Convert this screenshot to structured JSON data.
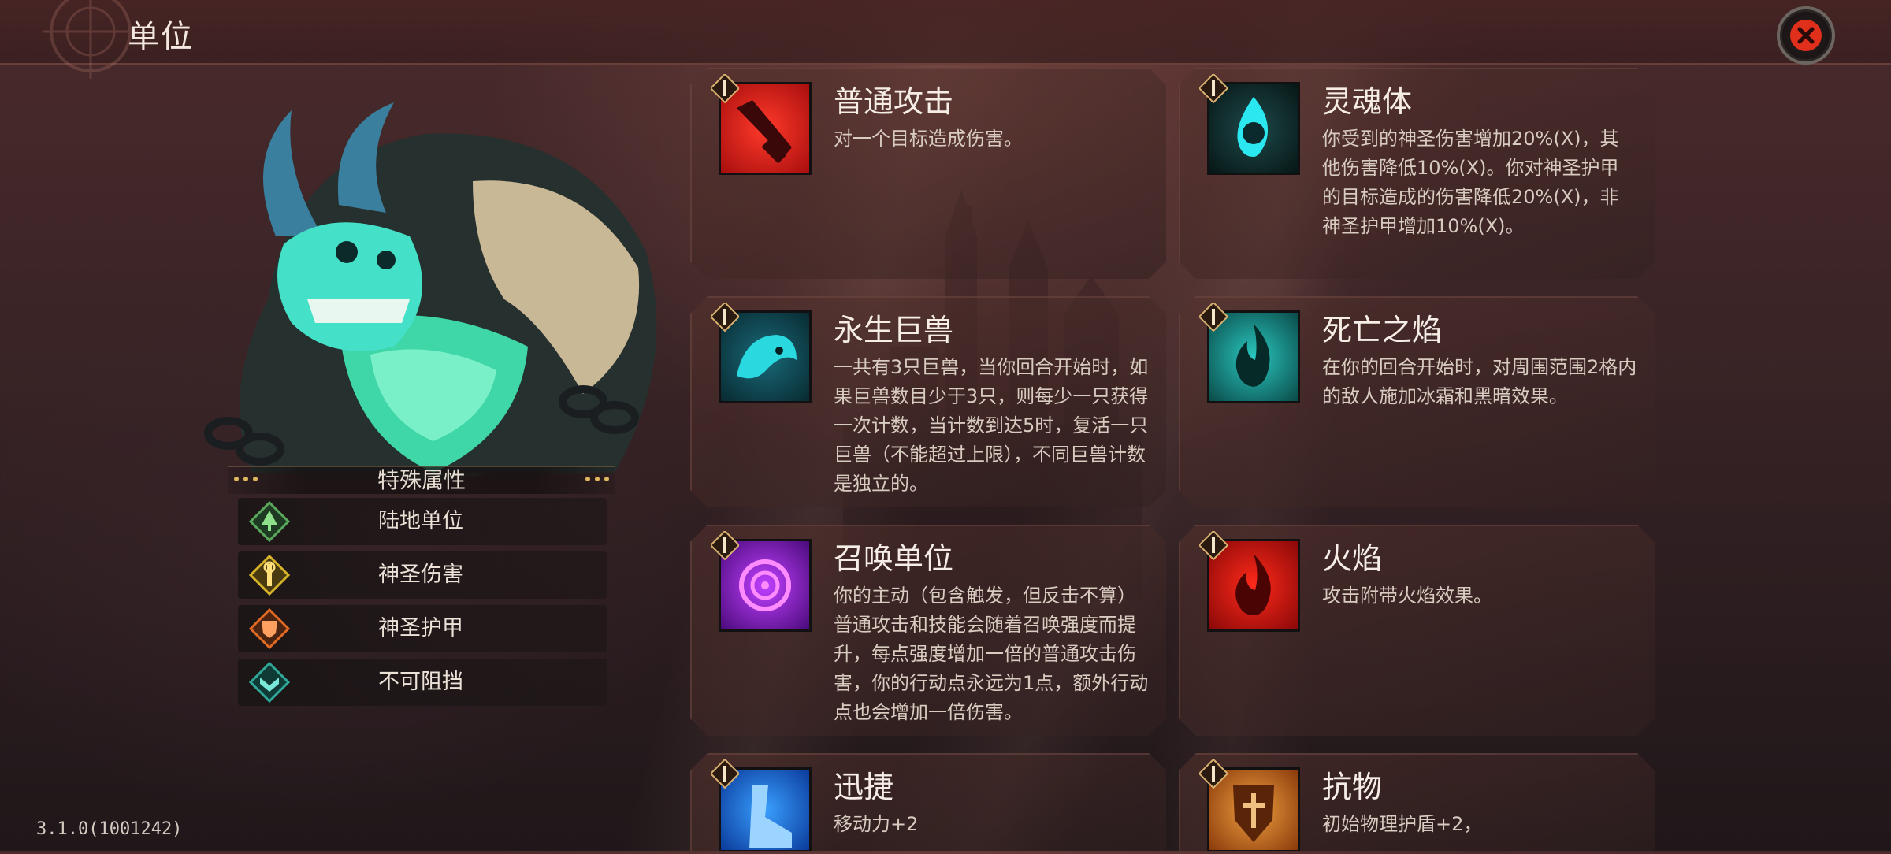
{
  "header": {
    "title": "单位"
  },
  "attributes": {
    "heading": "特殊属性",
    "items": [
      {
        "label": "陆地单位",
        "icon": "land-unit-icon",
        "color": "#5aa85c"
      },
      {
        "label": "神圣伤害",
        "icon": "holy-damage-icon",
        "color": "#d8b42a"
      },
      {
        "label": "神圣护甲",
        "icon": "holy-armor-icon",
        "color": "#e06a24"
      },
      {
        "label": "不可阻挡",
        "icon": "unstoppable-icon",
        "color": "#2fa89a"
      }
    ]
  },
  "abilities": [
    {
      "name": "普通攻击",
      "desc": "对一个目标造成伤害。",
      "icon": "normal-attack-icon",
      "color": "#d8201e"
    },
    {
      "name": "灵魂体",
      "desc": "你受到的神圣伤害增加20%(X)，其他伤害降低10%(X)。你对神圣护甲的目标造成的伤害降低20%(X)，非神圣护甲增加10%(X)。",
      "icon": "soul-body-icon",
      "color": "#1fb7b7"
    },
    {
      "name": "永生巨兽",
      "desc": "一共有3只巨兽，当你回合开始时，如果巨兽数目少于3只，则每少一只获得一次计数，当计数到达5时，复活一只巨兽（不能超过上限），不同巨兽计数是独立的。",
      "icon": "immortal-beast-icon",
      "color": "#1a9aaa"
    },
    {
      "name": "死亡之焰",
      "desc": "在你的回合开始时，对周围范围2格内的敌人施加冰霜和黑暗效果。",
      "icon": "death-flame-icon",
      "color": "#1aa6a0"
    },
    {
      "name": "召唤单位",
      "desc": "你的主动（包含触发，但反击不算）普通攻击和技能会随着召唤强度而提升，每点强度增加一倍的普通攻击伤害，你的行动点永远为1点，额外行动点也会增加一倍伤害。",
      "icon": "summon-unit-icon",
      "color": "#9a2ad8"
    },
    {
      "name": "火焰",
      "desc": "攻击附带火焰效果。",
      "icon": "fire-icon",
      "color": "#d8201e"
    },
    {
      "name": "迅捷",
      "desc": "移动力+2",
      "icon": "swift-icon",
      "color": "#1e6fe0"
    },
    {
      "name": "抗物",
      "desc": "初始物理护盾+2，",
      "icon": "physical-resist-icon",
      "color": "#c8731e"
    }
  ],
  "footer": {
    "version": "3.1.0(1001242)"
  }
}
